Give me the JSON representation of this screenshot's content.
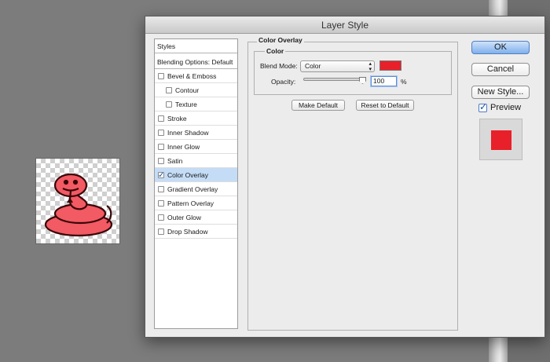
{
  "dialog": {
    "title": "Layer Style"
  },
  "styles_list": [
    {
      "label": "Styles",
      "kind": "header"
    },
    {
      "label": "Blending Options: Default",
      "kind": "header"
    },
    {
      "label": "Bevel & Emboss",
      "checked": false,
      "indent": 0
    },
    {
      "label": "Contour",
      "checked": false,
      "indent": 1
    },
    {
      "label": "Texture",
      "checked": false,
      "indent": 1
    },
    {
      "label": "Stroke",
      "checked": false,
      "indent": 0
    },
    {
      "label": "Inner Shadow",
      "checked": false,
      "indent": 0
    },
    {
      "label": "Inner Glow",
      "checked": false,
      "indent": 0
    },
    {
      "label": "Satin",
      "checked": false,
      "indent": 0
    },
    {
      "label": "Color Overlay",
      "checked": true,
      "indent": 0,
      "selected": true
    },
    {
      "label": "Gradient Overlay",
      "checked": false,
      "indent": 0
    },
    {
      "label": "Pattern Overlay",
      "checked": false,
      "indent": 0
    },
    {
      "label": "Outer Glow",
      "checked": false,
      "indent": 0
    },
    {
      "label": "Drop Shadow",
      "checked": false,
      "indent": 0
    }
  ],
  "color_overlay": {
    "section_title": "Color Overlay",
    "group_title": "Color",
    "blend_mode_label": "Blend Mode:",
    "blend_mode_value": "Color",
    "overlay_color": "#e8202a",
    "opacity_label": "Opacity:",
    "opacity_value": "100",
    "opacity_unit": "%",
    "opacity_fraction": 1.0,
    "make_default_label": "Make Default",
    "reset_default_label": "Reset to Default"
  },
  "buttons": {
    "ok": "OK",
    "cancel": "Cancel",
    "new_style": "New Style..."
  },
  "preview": {
    "label": "Preview",
    "checked": true,
    "swatch_color": "#e8202a"
  },
  "colors": {
    "snake_fill": "#f25a64",
    "snake_outline": "#3a0608",
    "snake_shadow": "#c8323c"
  }
}
